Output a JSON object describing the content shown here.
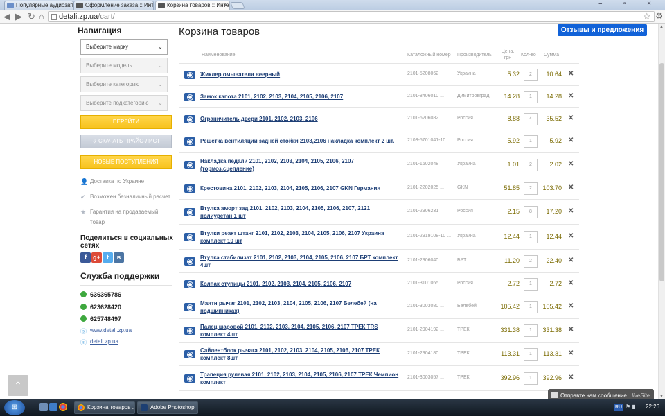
{
  "browser": {
    "tabs": [
      {
        "title": "Популярные аудиозап..."
      },
      {
        "title": "Оформление заказа :: Инте"
      },
      {
        "title": "Корзина товаров :: Интерн"
      }
    ],
    "url_host": "detali.zp.ua",
    "url_path": "/cart/"
  },
  "sidebar": {
    "title": "Навигация",
    "selects": [
      {
        "label": "Выберите марку"
      },
      {
        "label": "Выберите модель"
      },
      {
        "label": "Выберите категорию"
      },
      {
        "label": "Выберите подкатегорию"
      }
    ],
    "go_label": "ПЕРЕЙТИ",
    "price_list_label": "СКАЧАТЬ ПРАЙС-ЛИСТ",
    "new_arrivals_label": "НОВЫЕ ПОСТУПЛЕНИЯ",
    "features": [
      {
        "text": "Доставка по Украине",
        "icon": "person-icon"
      },
      {
        "text": "Возможен безналичный расчет",
        "icon": "check-icon"
      },
      {
        "text": "Гарантия на продаваемый товар",
        "icon": "star-icon"
      }
    ],
    "share_title": "Поделиться в социальных сетях",
    "social": [
      {
        "label": "f",
        "color": "#3b5998"
      },
      {
        "label": "g+",
        "color": "#dd4b39"
      },
      {
        "label": "t",
        "color": "#55acee"
      },
      {
        "label": "в",
        "color": "#4c75a3"
      }
    ],
    "support_title": "Служба поддержки",
    "phones": [
      "636365786",
      "623628420",
      "625748497"
    ],
    "links": [
      "www.detali.zp.ua",
      "detali.zp.ua"
    ]
  },
  "main": {
    "title": "Корзина товаров",
    "feedback_label": "Отзывы и предложения",
    "columns": {
      "name": "Наименование",
      "article": "Каталожный номер",
      "manufacturer": "Производитель",
      "price": "Цена, грн",
      "qty": "Кол-во",
      "sum": "Сумма"
    },
    "rows": [
      {
        "name": "Жиклер омывателя веерный",
        "article": "2101-5208062",
        "mfr": "Украина",
        "price": "5.32",
        "qty": "2",
        "sum": "10.64"
      },
      {
        "name": "Замок капота 2101, 2102, 2103, 2104, 2105, 2106, 2107",
        "article": "2101-8406010 ...",
        "mfr": "Димитровград",
        "price": "14.28",
        "qty": "1",
        "sum": "14.28"
      },
      {
        "name": "Ограничитель двери 2101, 2102, 2103, 2106",
        "article": "2101-6206082",
        "mfr": "Россия",
        "price": "8.88",
        "qty": "4",
        "sum": "35.52"
      },
      {
        "name": "Решетка вентиляции задней стойки 2103,2106 накладка комплект 2 шт.",
        "article": "2103-5701041-10 ...",
        "mfr": "Россия",
        "price": "5.92",
        "qty": "1",
        "sum": "5.92"
      },
      {
        "name": "Накладка педали 2101, 2102, 2103, 2104, 2105, 2106, 2107 (тормоз,сцепление)",
        "article": "2101-1602048",
        "mfr": "Украина",
        "price": "1.01",
        "qty": "2",
        "sum": "2.02"
      },
      {
        "name": "Крестовина 2101, 2102, 2103, 2104, 2105, 2106, 2107 GKN Германия",
        "article": "2101-2202025 ...",
        "mfr": "GKN",
        "price": "51.85",
        "qty": "2",
        "sum": "103.70"
      },
      {
        "name": "Втулка аморт зад 2101, 2102, 2103, 2104, 2105, 2106, 2107, 2121 полиуретан 1 шт",
        "article": "2101-2906231",
        "mfr": "Россия",
        "price": "2.15",
        "qty": "8",
        "sum": "17.20"
      },
      {
        "name": "Втулки реакт штанг 2101, 2102, 2103, 2104, 2105, 2106, 2107 Украина комплект 10 шт",
        "article": "2101-2919108-10 ...",
        "mfr": "Украина",
        "price": "12.44",
        "qty": "1",
        "sum": "12.44"
      },
      {
        "name": "Втулка стабилизат 2101, 2102, 2103, 2104, 2105, 2106, 2107 БРТ комплект 4шт",
        "article": "2101-2906040",
        "mfr": "БРТ",
        "price": "11.20",
        "qty": "2",
        "sum": "22.40"
      },
      {
        "name": "Колпак ступицы 2101, 2102, 2103, 2104, 2105, 2106, 2107",
        "article": "2101-3101065",
        "mfr": "Россия",
        "price": "2.72",
        "qty": "1",
        "sum": "2.72"
      },
      {
        "name": "Маятн рычаг 2101, 2102, 2103, 2104, 2105, 2106, 2107 Белебей (на подшипниках)",
        "article": "2101-3003080 ...",
        "mfr": "Белебей",
        "price": "105.42",
        "qty": "1",
        "sum": "105.42"
      },
      {
        "name": "Палец шаровой 2101, 2102, 2103, 2104, 2105, 2106, 2107 ТРЕК TRS комплект 4шт",
        "article": "2101-2904192 ...",
        "mfr": "ТРЕК",
        "price": "331.38",
        "qty": "1",
        "sum": "331.38"
      },
      {
        "name": "Сайлентблок рычага 2101, 2102, 2103, 2104, 2105, 2106, 2107 ТРЕК комплект 8шт",
        "article": "2101-2904180 ...",
        "mfr": "ТРЕК",
        "price": "113.31",
        "qty": "1",
        "sum": "113.31"
      },
      {
        "name": "Трапеция рулевая 2101, 2102, 2103, 2104, 2105, 2106, 2107 ТРЕК Чемпион комплект",
        "article": "2101-3003057 ...",
        "mfr": "ТРЕК",
        "price": "392.96",
        "qty": "1",
        "sum": "392.96"
      }
    ]
  },
  "chat": {
    "label": "Отправте нам сообщение",
    "brand": "liveSite"
  },
  "taskbar": {
    "tasks": [
      {
        "label": "Корзина товаров ..."
      },
      {
        "label": "Adobe Photoshop"
      }
    ],
    "lang": "RU",
    "time": "22:26"
  }
}
